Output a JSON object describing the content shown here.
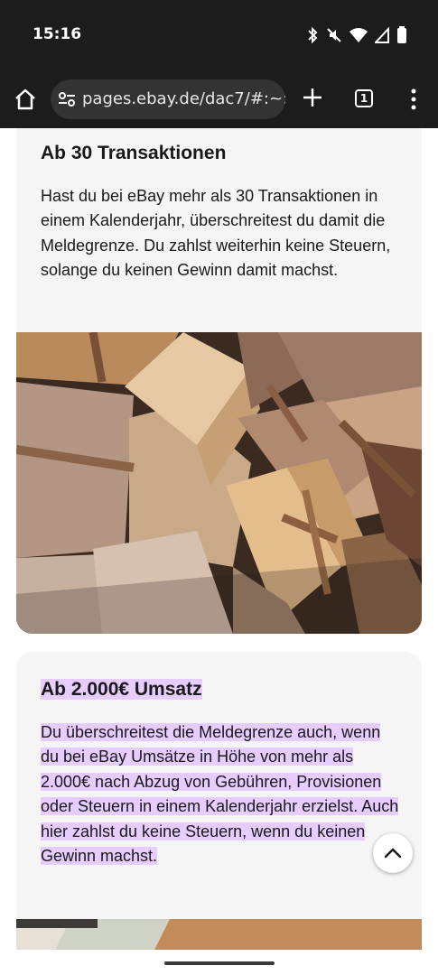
{
  "status_bar": {
    "time": "15:16",
    "icons": [
      "bluetooth-icon",
      "muted-icon",
      "wifi-icon",
      "signal-icon",
      "battery-icon"
    ]
  },
  "browser": {
    "url": "pages.ebay.de/dac7/#:~:t",
    "tab_count": "1",
    "icons": [
      "home-icon",
      "site-settings-icon",
      "new-tab-plus-icon",
      "tab-switcher-icon",
      "more-menu-icon"
    ]
  },
  "sections": [
    {
      "title": "Ab 30 Transaktionen",
      "text": "Hast du bei eBay mehr als 30 Transaktionen in einem Kalenderjahr, überschreitest du damit die Meldegrenze. Du zahlst weiterhin keine Steuern, solange du keinen Gewinn damit machst."
    },
    {
      "title": "Ab 2.000€ Umsatz",
      "text": "Du überschreitest die Meldegrenze auch, wenn du bei eBay Umsätze in Höhe von mehr als 2.000€ nach Abzug von Gebühren, Provisionen oder Steuern in einem Kalenderjahr erzielst. Auch hier zahlst du keine Steuern, wenn du keinen Gewinn machst."
    }
  ],
  "colors": {
    "system_bar": "#1c1c1c",
    "card_background": "#f5f5f5",
    "highlight": "#e7ccff",
    "text": "#191919"
  }
}
